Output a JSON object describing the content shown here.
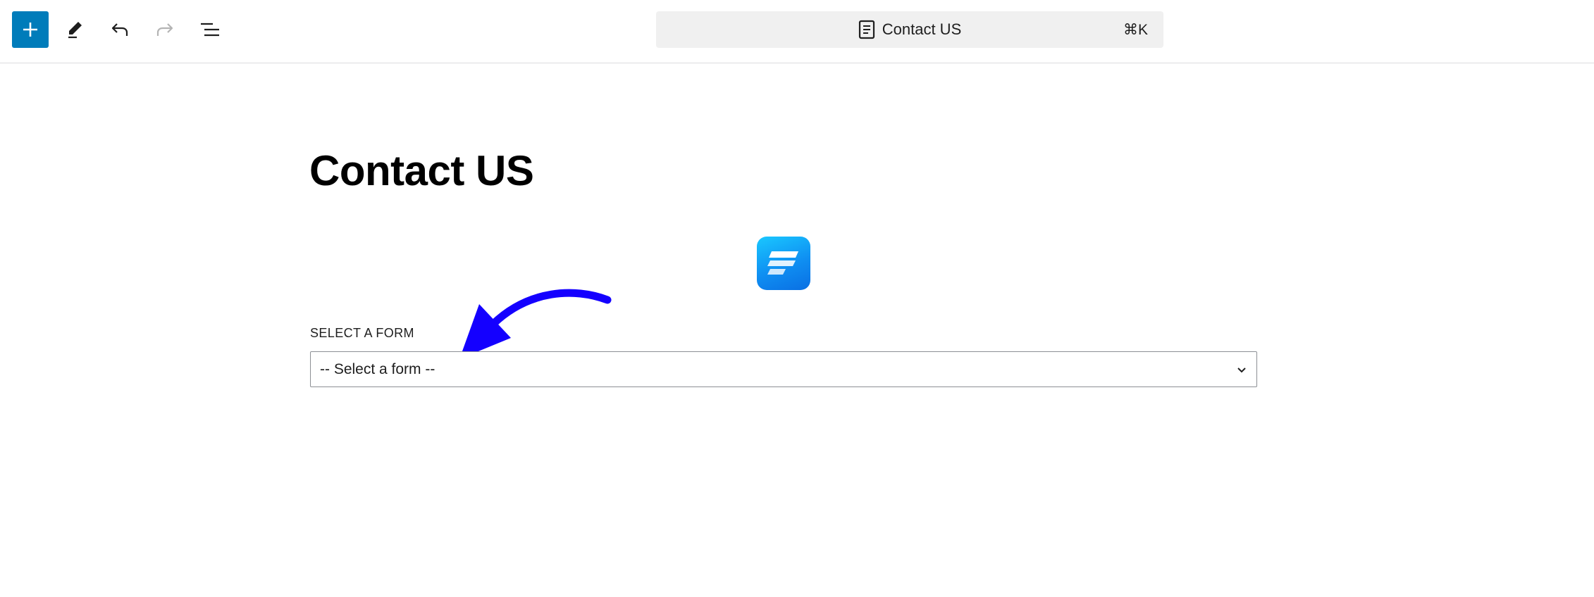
{
  "toolbar": {
    "inserter_icon": "plus-icon",
    "tools_icon": "pencil-icon",
    "undo_icon": "undo-icon",
    "redo_icon": "redo-icon",
    "list_view_icon": "list-view-icon",
    "accent_color": "#007cba"
  },
  "command_bar": {
    "icon": "page-icon",
    "title": "Contact US",
    "shortcut": "⌘K"
  },
  "content": {
    "page_title": "Contact US",
    "form_block": {
      "logo_icon": "fluent-forms-logo-icon",
      "select_label": "SELECT A FORM",
      "select_value": "-- Select a form --"
    },
    "annotation": {
      "icon": "blue-arrow-annotation",
      "color": "#1400ff"
    }
  }
}
